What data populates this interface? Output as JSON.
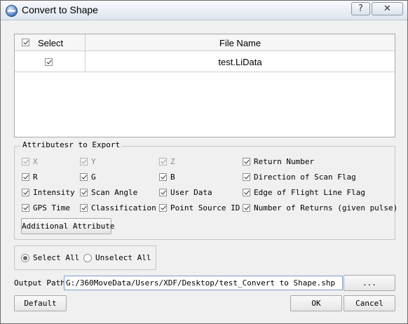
{
  "window": {
    "title": "Convert to Shape",
    "help_label": "?",
    "close_label": "✕"
  },
  "table": {
    "header_select": "Select",
    "header_file_name": "File Name",
    "header_select_checked": true,
    "rows": [
      {
        "selected": true,
        "file_name": "test.LiData"
      }
    ]
  },
  "attributes": {
    "group_title": "Attributesr to Export",
    "items": [
      {
        "label": "X",
        "checked": true,
        "enabled": false
      },
      {
        "label": "Y",
        "checked": true,
        "enabled": false
      },
      {
        "label": "Z",
        "checked": true,
        "enabled": false
      },
      {
        "label": "Return Number",
        "checked": true,
        "enabled": true
      },
      {
        "label": "R",
        "checked": true,
        "enabled": true
      },
      {
        "label": "G",
        "checked": true,
        "enabled": true
      },
      {
        "label": "B",
        "checked": true,
        "enabled": true
      },
      {
        "label": "Direction of Scan Flag",
        "checked": true,
        "enabled": true
      },
      {
        "label": "Intensity",
        "checked": true,
        "enabled": true
      },
      {
        "label": "Scan Angle",
        "checked": true,
        "enabled": true
      },
      {
        "label": "User Data",
        "checked": true,
        "enabled": true
      },
      {
        "label": "Edge of Flight Line Flag",
        "checked": true,
        "enabled": true
      },
      {
        "label": "GPS Time",
        "checked": true,
        "enabled": true
      },
      {
        "label": "Classification",
        "checked": true,
        "enabled": true
      },
      {
        "label": "Point Source ID",
        "checked": true,
        "enabled": true
      },
      {
        "label": "Number of Returns (given pulse)",
        "checked": true,
        "enabled": true
      }
    ],
    "additional_button": "Additional Attribute"
  },
  "selection": {
    "select_all": "Select All",
    "unselect_all": "Unselect All",
    "selected": "select_all"
  },
  "output": {
    "label": "Output Path:",
    "path": "G:/360MoveData/Users/XDF/Desktop/test_Convert to Shape.shp",
    "browse_label": "..."
  },
  "buttons": {
    "default": "Default",
    "ok": "OK",
    "cancel": "Cancel"
  }
}
